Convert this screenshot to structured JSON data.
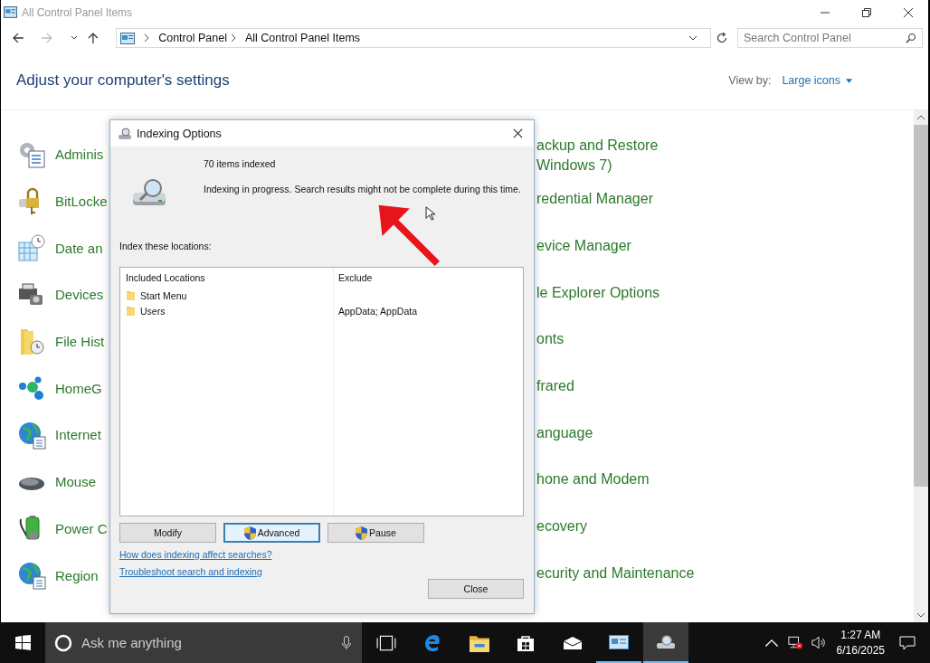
{
  "window": {
    "title": "All Control Panel Items"
  },
  "address": {
    "breadcrumb": [
      "Control Panel",
      "All Control Panel Items"
    ],
    "search": {
      "placeholder": "Search Control Panel"
    }
  },
  "header": {
    "heading": "Adjust your computer's settings",
    "view_by_label": "View by:",
    "view_by_value": "Large icons"
  },
  "items_left": [
    {
      "label": "Adminis",
      "kind": "tools"
    },
    {
      "label": "BitLocke",
      "kind": "lock"
    },
    {
      "label": "Date an",
      "kind": "calendar"
    },
    {
      "label": "Devices",
      "kind": "printer"
    },
    {
      "label": "File Hist",
      "kind": "folder"
    },
    {
      "label": "HomeG",
      "kind": "dots"
    },
    {
      "label": "Internet",
      "kind": "globe"
    },
    {
      "label": "Mouse",
      "kind": "mouse"
    },
    {
      "label": "Power C",
      "kind": "battery"
    },
    {
      "label": "Region",
      "kind": "globe"
    }
  ],
  "items_right": [
    {
      "label": "ackup and Restore Windows 7)"
    },
    {
      "label": "redential Manager"
    },
    {
      "label": "evice Manager"
    },
    {
      "label": "le Explorer Options"
    },
    {
      "label": "onts"
    },
    {
      "label": "frared"
    },
    {
      "label": "anguage"
    },
    {
      "label": "hone and Modem"
    },
    {
      "label": "ecovery"
    },
    {
      "label": "ecurity and Maintenance"
    }
  ],
  "dialog": {
    "title": "Indexing Options",
    "items_indexed": "70 items indexed",
    "status": "Indexing in progress. Search results might not be complete during this time.",
    "locations_label": "Index these locations:",
    "columns": [
      "Included Locations",
      "Exclude"
    ],
    "rows": [
      {
        "location": "Start Menu"
      },
      {
        "location": "Users",
        "exclude": "AppData; AppData"
      }
    ],
    "buttons": [
      {
        "label": "Modify",
        "shield": false,
        "focused": false
      },
      {
        "label": "Advanced",
        "shield": true,
        "focused": true
      },
      {
        "label": "Pause",
        "shield": true,
        "focused": false
      }
    ],
    "links": [
      "How does indexing affect searches?",
      "Troubleshoot search and indexing"
    ],
    "close_button": "Close"
  },
  "taskbar": {
    "search": {
      "placeholder": "Ask me anything"
    },
    "apps": [
      {
        "kind": "taskview",
        "open": false,
        "selected": false
      },
      {
        "kind": "edge",
        "open": false,
        "selected": false
      },
      {
        "kind": "explorer",
        "open": false,
        "selected": false
      },
      {
        "kind": "store",
        "open": false,
        "selected": false
      },
      {
        "kind": "mail",
        "open": false,
        "selected": false
      },
      {
        "kind": "controlpanel",
        "open": true,
        "selected": false
      },
      {
        "kind": "indexing",
        "open": true,
        "selected": true
      }
    ],
    "time": "1:27 AM",
    "date": "6/16/2025"
  }
}
